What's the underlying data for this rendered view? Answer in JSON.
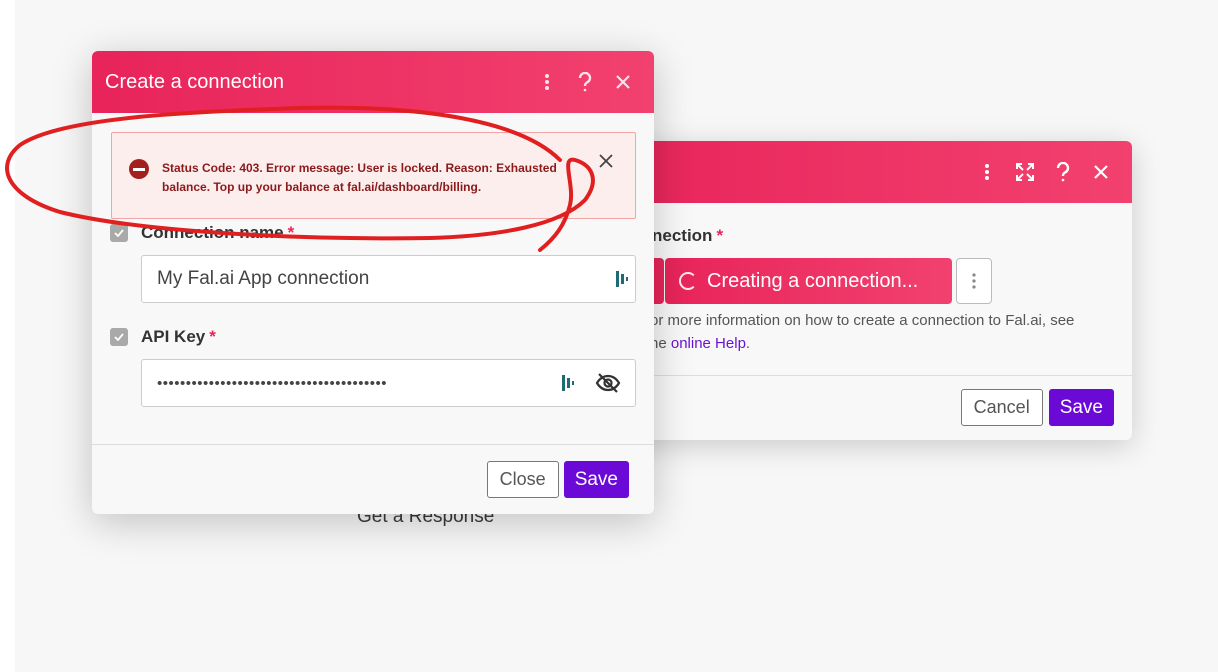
{
  "background": {
    "label": "Get a Response"
  },
  "back_modal": {
    "field_label": "nection",
    "required_mark": "*",
    "creating_button_label": "Creating a connection...",
    "help_line1": "or more information on how to create a connection to Fal.ai, see",
    "help_line2_prefix": "ne ",
    "help_link": "online Help",
    "help_line2_suffix": ".",
    "cancel_label": "Cancel",
    "save_label": "Save"
  },
  "front_modal": {
    "title": "Create a connection",
    "error": {
      "message": "Status Code: 403. Error message: User is locked. Reason: Exhausted balance. Top up your balance at fal.ai/dashboard/billing."
    },
    "connection_name": {
      "label": "Connection name",
      "required_mark": "*",
      "value": "My Fal.ai App connection"
    },
    "api_key": {
      "label": "API Key",
      "required_mark": "*",
      "masked_value": "••••••••••••••••••••••••••••••••••••••••"
    },
    "close_label": "Close",
    "save_label": "Save"
  },
  "colors": {
    "header_pink": "#e8245a",
    "primary_purple": "#6b0ad6",
    "error_text": "#8b1a1a",
    "annotation_red": "#e02020"
  },
  "icons": {
    "header": [
      "kebab-icon",
      "expand-icon",
      "help-icon",
      "close-icon"
    ],
    "error": "minus-circle-icon",
    "field": [
      "checkbox-icon",
      "password-manager-icon",
      "eye-off-icon"
    ]
  }
}
